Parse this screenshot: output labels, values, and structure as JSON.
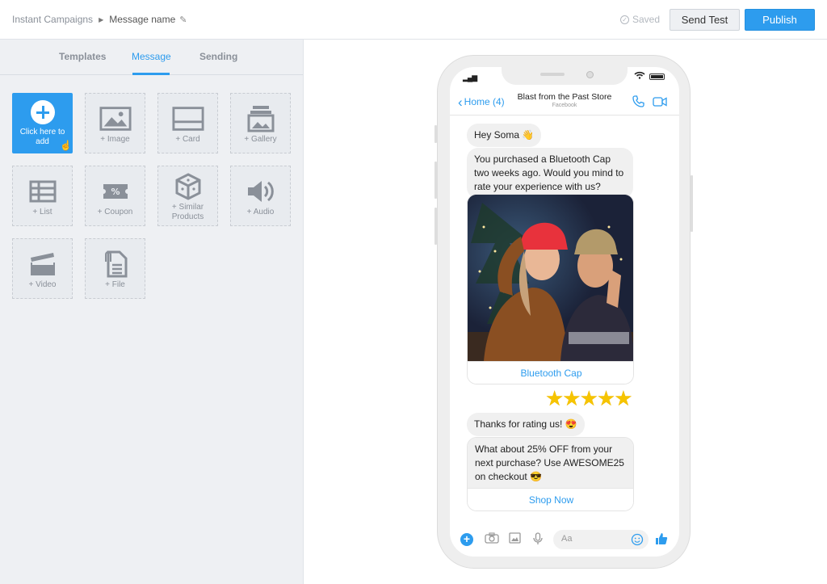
{
  "header": {
    "breadcrumb_root": "Instant Campaigns",
    "breadcrumb_current": "Message name",
    "saved_label": "Saved",
    "send_test_label": "Send Test",
    "publish_label": "Publish"
  },
  "tabs": [
    {
      "label": "Templates",
      "active": false
    },
    {
      "label": "Message",
      "active": true
    },
    {
      "label": "Sending",
      "active": false
    }
  ],
  "tiles": {
    "add": "Click here to add",
    "image": "+ Image",
    "card": "+ Card",
    "gallery": "+ Gallery",
    "list": "+ List",
    "coupon": "+ Coupon",
    "similar": "+ Similar Products",
    "audio": "+ Audio",
    "video": "+ Video",
    "file": "+ File"
  },
  "preview": {
    "back_label": "Home (4)",
    "store_name": "Blast from the Past Store",
    "store_platform": "Facebook",
    "messages": {
      "greeting": "Hey Soma 👋",
      "question": "You purchased a Bluetooth Cap two weeks ago. Would you mind to rate your experience with us?",
      "product_button": "Bluetooth Cap",
      "stars": "★★★★★",
      "thanks": "Thanks for rating us! 😍",
      "offer": "What about 25% OFF from your next purchase? Use AWESOME25 on checkout 😎",
      "offer_button": "Shop Now"
    },
    "rating": 5,
    "composer_placeholder": "Aa"
  },
  "colors": {
    "accent": "#2d9cee",
    "panel_bg": "#eef0f3",
    "bubble_bg": "#f0f0f0",
    "star": "#f6c400"
  }
}
